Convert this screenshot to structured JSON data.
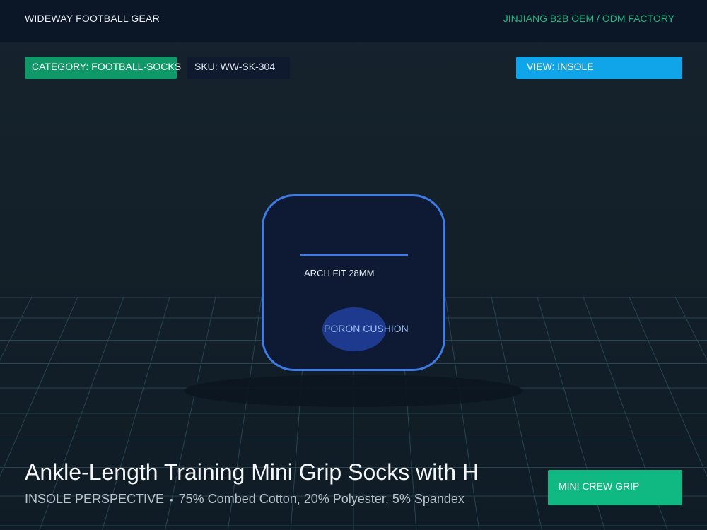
{
  "header": {
    "brand": "WIDEWAY FOOTBALL GEAR",
    "factory": "JINJIANG B2B OEM / ODM FACTORY"
  },
  "tags": {
    "category": "CATEGORY: FOOTBALL-SOCKS",
    "sku": "SKU: WW-SK-304",
    "view": "VIEW: INSOLE"
  },
  "product": {
    "arch_label": "ARCH FIT 28MM",
    "cushion_label": "PORON CUSHION",
    "title": "Ankle-Length Training Mini Grip Socks with H",
    "perspective": "INSOLE PERSPECTIVE",
    "separator": "•",
    "material": "75% Combed Cotton, 20% Polyester, 5% Spandex"
  },
  "cta": {
    "label": "MINI CREW GRIP"
  },
  "colors": {
    "accent_green": "#10b981",
    "accent_blue": "#10a4e8",
    "outline_blue": "#3d7be6",
    "background": "#132029"
  }
}
